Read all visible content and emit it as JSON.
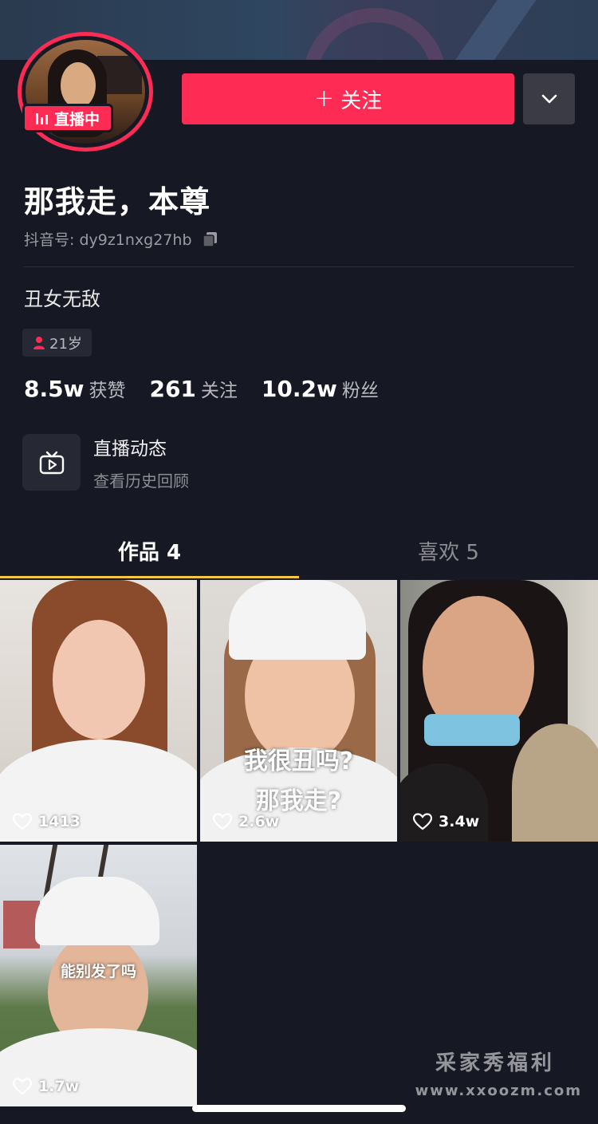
{
  "header": {
    "live_badge_label": "直播中",
    "follow_button_label": "关注",
    "follow_plus": "+"
  },
  "profile": {
    "nickname": "那我走，本尊",
    "douyin_id": "抖音号: dy9z1nxg27hb",
    "bio": "丑女无敌",
    "age_tag": "21岁"
  },
  "stats": [
    {
      "value": "8.5w",
      "label": "获赞"
    },
    {
      "value": "261",
      "label": "关注"
    },
    {
      "value": "10.2w",
      "label": "粉丝"
    }
  ],
  "live_history": {
    "title": "直播动态",
    "subtitle": "查看历史回顾"
  },
  "tabs": [
    {
      "label": "作品 4",
      "active": true
    },
    {
      "label": "喜欢 5",
      "active": false
    }
  ],
  "videos": [
    {
      "likes": "1413",
      "caption": ""
    },
    {
      "likes": "2.6w",
      "caption_line1": "我很丑吗?",
      "caption_line2": "那我走?"
    },
    {
      "likes": "3.4w",
      "caption": ""
    },
    {
      "likes": "1.7w",
      "caption": "能别发了吗"
    }
  ],
  "watermark": {
    "line1": "采家秀福利",
    "line2": "www.xxoozm.com"
  },
  "colors": {
    "background": "#161823",
    "accent": "#fe2c55",
    "tab_indicator": "#f7c844"
  },
  "icons": {
    "more": "chevron-down-icon",
    "copy": "copy-icon",
    "age": "person-icon",
    "live_history": "tv-play-icon",
    "like": "heart-icon"
  }
}
